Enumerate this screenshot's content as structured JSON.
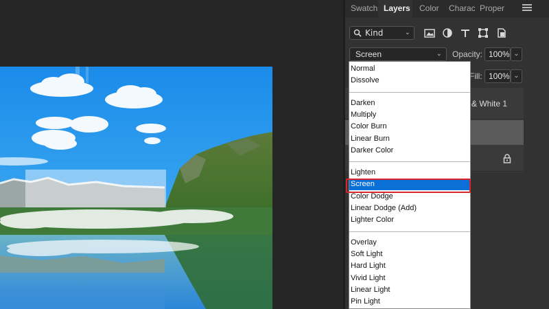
{
  "panel": {
    "tabs": [
      {
        "label": "Swatch",
        "active": false
      },
      {
        "label": "Layers",
        "active": true
      },
      {
        "label": "Color",
        "active": false
      },
      {
        "label": "Charac",
        "active": false
      },
      {
        "label": "Proper",
        "active": false
      }
    ],
    "filter": {
      "kind_label": "Kind",
      "icons": [
        "image-filter-icon",
        "adjustment-filter-icon",
        "type-filter-icon",
        "shape-filter-icon",
        "smart-object-filter-icon",
        "filter-toggle-icon"
      ]
    },
    "blend_mode": "Screen",
    "opacity_label": "Opacity:",
    "opacity_value": "100%",
    "fill_label": "Fill:",
    "fill_value": "100%",
    "layers": [
      {
        "name": "& White 1"
      },
      {
        "name": ""
      },
      {
        "name": "",
        "locked": true
      }
    ]
  },
  "blend_dropdown": {
    "groups": [
      [
        "Normal",
        "Dissolve"
      ],
      [
        "Darken",
        "Multiply",
        "Color Burn",
        "Linear Burn",
        "Darker Color"
      ],
      [
        "Lighten",
        "Screen",
        "Color Dodge",
        "Linear Dodge (Add)",
        "Lighter Color"
      ],
      [
        "Overlay",
        "Soft Light",
        "Hard Light",
        "Vivid Light",
        "Linear Light",
        "Pin Light"
      ]
    ],
    "selected": "Screen"
  },
  "colors": {
    "selection_blue": "#0a6fd6",
    "highlight_red": "#d8242a",
    "panel_bg": "#323232"
  }
}
